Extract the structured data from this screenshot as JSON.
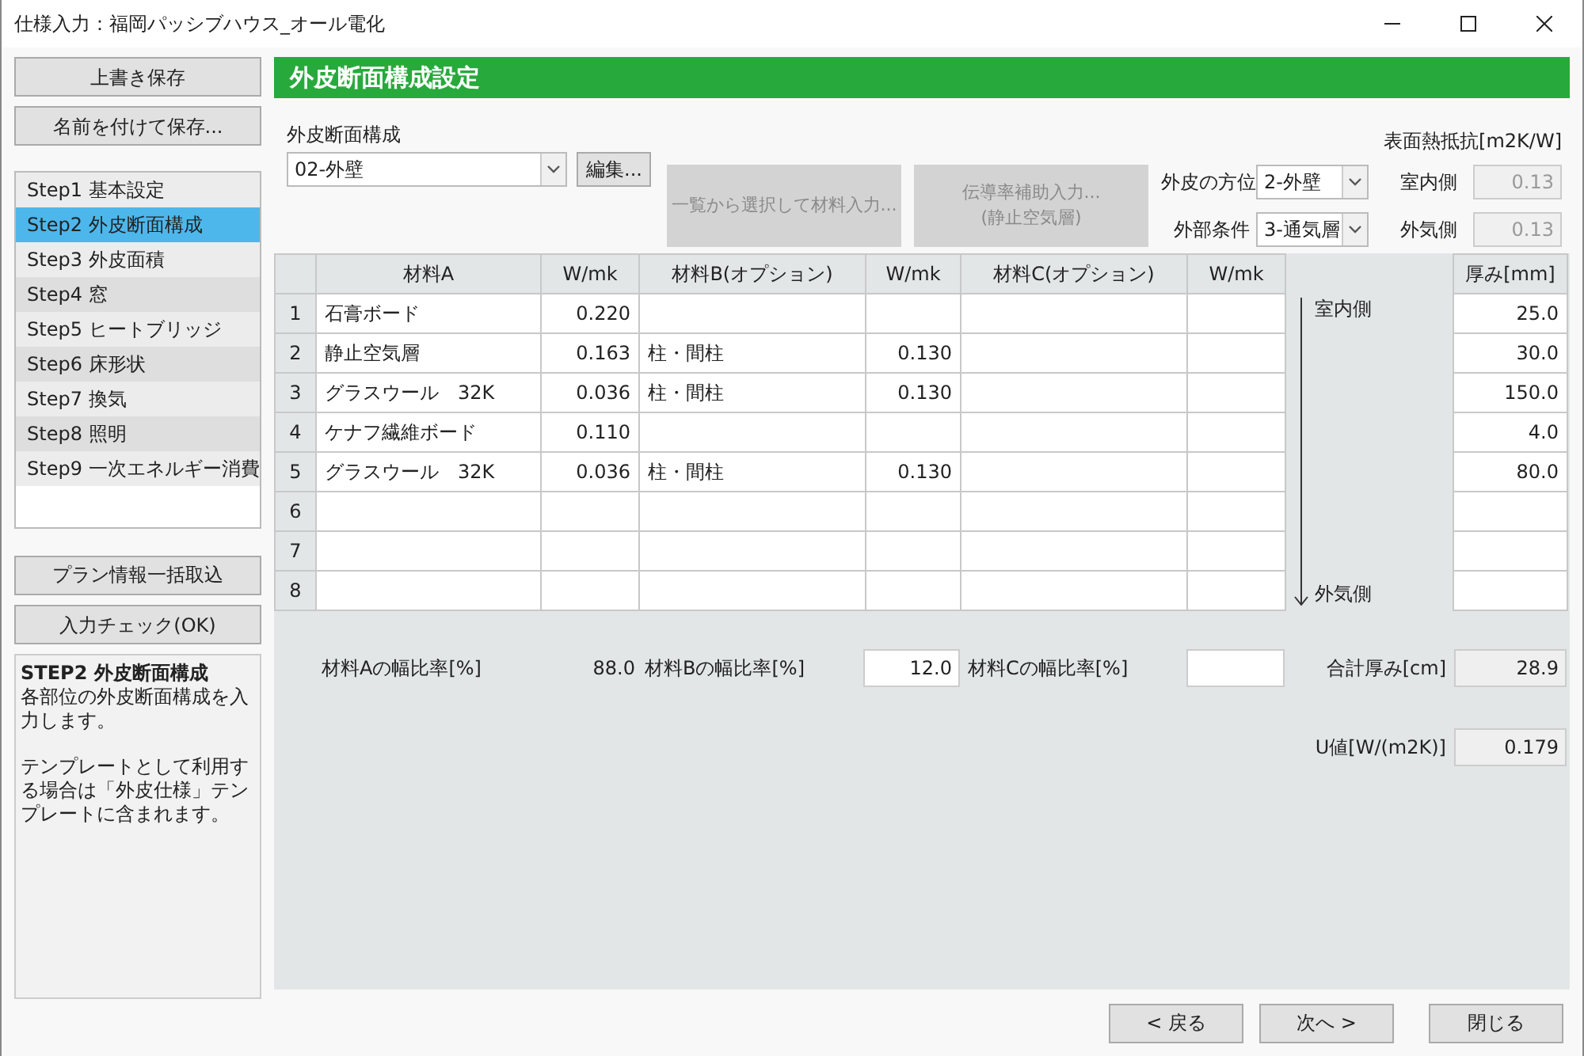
{
  "window": {
    "title": "仕様入力：福岡パッシブハウス_オール電化"
  },
  "sidebar": {
    "save_buttons": [
      "上書き保存",
      "名前を付けて保存..."
    ],
    "steps": [
      {
        "label": "Step1 基本設定",
        "selected": false
      },
      {
        "label": "Step2 外皮断面構成",
        "selected": true
      },
      {
        "label": "Step3 外皮面積",
        "selected": false
      },
      {
        "label": "Step4 窓",
        "selected": false
      },
      {
        "label": "Step5 ヒートブリッジ",
        "selected": false
      },
      {
        "label": "Step6 床形状",
        "selected": false
      },
      {
        "label": "Step7 換気",
        "selected": false
      },
      {
        "label": "Step8 照明",
        "selected": false
      },
      {
        "label": "Step9 一次エネルギー消費",
        "selected": false
      }
    ],
    "action_buttons": [
      "プラン情報一括取込",
      "入力チェック(OK)"
    ],
    "help": {
      "title": "STEP2 外皮断面構成",
      "paragraphs": [
        "各部位の外皮断面構成を入力します。",
        "テンプレートとして利用する場合は「外皮仕様」テンプレートに含まれます。"
      ]
    }
  },
  "main": {
    "header": "外皮断面構成設定",
    "section_select": {
      "label": "外皮断面構成",
      "value": "02-外壁"
    },
    "edit_button": "編集...",
    "tool_buttons": [
      {
        "lines": [
          "一覧から選択して材料入力..."
        ],
        "disabled": true
      },
      {
        "lines": [
          "伝導率補助入力...",
          "(静止空気層)"
        ],
        "disabled": true
      }
    ],
    "orientation": {
      "label": "外皮の方位",
      "value": "2-外壁"
    },
    "outside_condition": {
      "label": "外部条件",
      "value": "3-通気層"
    },
    "surface_resistance": {
      "title": "表面熱抵抗[m2K/W]",
      "inside": {
        "label": "室内側",
        "value": "0.13"
      },
      "outside": {
        "label": "外気側",
        "value": "0.13"
      }
    },
    "table": {
      "columns": [
        "材料A",
        "W/mk",
        "材料B(オプション)",
        "W/mk",
        "材料C(オプション)",
        "W/mk",
        "厚み[mm]"
      ],
      "direction": {
        "top": "室内側",
        "bottom": "外気側"
      },
      "rows": [
        {
          "number": "1",
          "cells": [
            "石膏ボード",
            "0.220",
            "",
            "",
            "",
            "",
            "25.0"
          ]
        },
        {
          "number": "2",
          "cells": [
            "静止空気層",
            "0.163",
            "柱・間柱",
            "0.130",
            "",
            "",
            "30.0"
          ]
        },
        {
          "number": "3",
          "cells": [
            "グラスウール　32K",
            "0.036",
            "柱・間柱",
            "0.130",
            "",
            "",
            "150.0"
          ]
        },
        {
          "number": "4",
          "cells": [
            "ケナフ繊維ボード",
            "0.110",
            "",
            "",
            "",
            "",
            "4.0"
          ]
        },
        {
          "number": "5",
          "cells": [
            "グラスウール　32K",
            "0.036",
            "柱・間柱",
            "0.130",
            "",
            "",
            "80.0"
          ]
        },
        {
          "number": "6",
          "cells": [
            "",
            "",
            "",
            "",
            "",
            "",
            ""
          ]
        },
        {
          "number": "7",
          "cells": [
            "",
            "",
            "",
            "",
            "",
            "",
            ""
          ]
        },
        {
          "number": "8",
          "cells": [
            "",
            "",
            "",
            "",
            "",
            "",
            ""
          ]
        }
      ]
    },
    "ratio_a": {
      "label": "材料Aの幅比率[%]",
      "value": "88.0"
    },
    "ratio_b": {
      "label": "材料Bの幅比率[%]",
      "value": "12.0"
    },
    "ratio_c": {
      "label": "材料Cの幅比率[%]"
    },
    "total_thickness": {
      "label": "合計厚み[cm]",
      "value": "28.9"
    },
    "u_value": {
      "label": "U値[W/(m2K)]",
      "value": "0.179"
    }
  },
  "footer_buttons": [
    "< 戻る",
    "次へ >",
    "閉じる"
  ]
}
